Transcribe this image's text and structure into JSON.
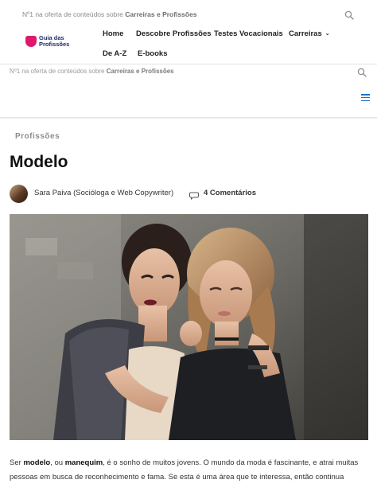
{
  "header": {
    "tagline_prefix": "Nº1 na oferta de conteúdos sobre",
    "tagline_bold": "Carreiras e Profissões",
    "logo_text_line1": "Guia das",
    "logo_text_line2": "Profissões",
    "nav": {
      "inicio": "Home",
      "descobre": "Descobre Profissões",
      "testes": "Testes Vocacionais",
      "carreiras": "Carreiras",
      "deaz": "De A-Z",
      "ebooks": "E-books"
    },
    "search_icon": "search-icon"
  },
  "mobile_header": {
    "tagline_prefix": "Nº1 na oferta de conteúdos sobre",
    "tagline_bold": "Carreiras e Profissões",
    "menu_icon": "hamburger-menu-icon"
  },
  "article": {
    "category": "Profissões",
    "title": "Modelo",
    "author": "Sara Paiva (Socióloga e Web Copywriter)",
    "comments": "4 Comentários",
    "intro_pre": "Ser",
    "intro_bold1": "modelo",
    "intro_mid": ", ou",
    "intro_bold2": "manequim",
    "intro_post": ", é o sonho de muitos jovens. O mundo da moda é fascinante, e atrai muitas pessoas em busca de reconhecimento e fama. Se esta é uma área que te interessa, então continua"
  },
  "colors": {
    "brand_pink": "#e0176c",
    "brand_navy": "#1b2a6b",
    "accent_blue": "#1a73c8"
  }
}
